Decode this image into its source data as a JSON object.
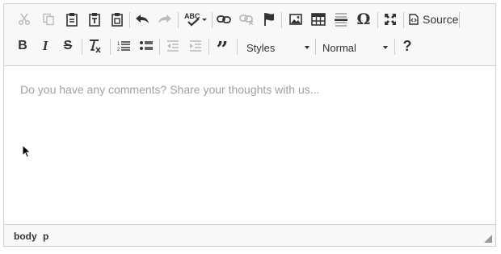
{
  "toolbar": {
    "source_label": "Source",
    "styles_label": "Styles",
    "format_label": "Normal",
    "icons": [
      "cut-icon",
      "copy-icon",
      "paste-icon",
      "paste-text-icon",
      "paste-word-icon",
      "undo-icon",
      "redo-icon",
      "spellcheck-icon",
      "link-icon",
      "unlink-icon",
      "anchor-icon",
      "image-icon",
      "table-icon",
      "horizontal-line-icon",
      "special-char-icon",
      "maximize-icon",
      "source-icon",
      "bold-icon",
      "italic-icon",
      "strike-icon",
      "remove-format-icon",
      "numbered-list-icon",
      "bulleted-list-icon",
      "outdent-icon",
      "indent-icon",
      "blockquote-icon",
      "help-icon"
    ]
  },
  "content": {
    "placeholder": "Do you have any comments? Share your thoughts with us..."
  },
  "status": {
    "path": [
      "body",
      "p"
    ]
  },
  "colors": {
    "toolbar_bg": "#f8f8f8",
    "border": "#d1d1d1",
    "icon_active": "#333333",
    "icon_disabled": "#b8b8b8",
    "placeholder": "#a0a0a0"
  }
}
